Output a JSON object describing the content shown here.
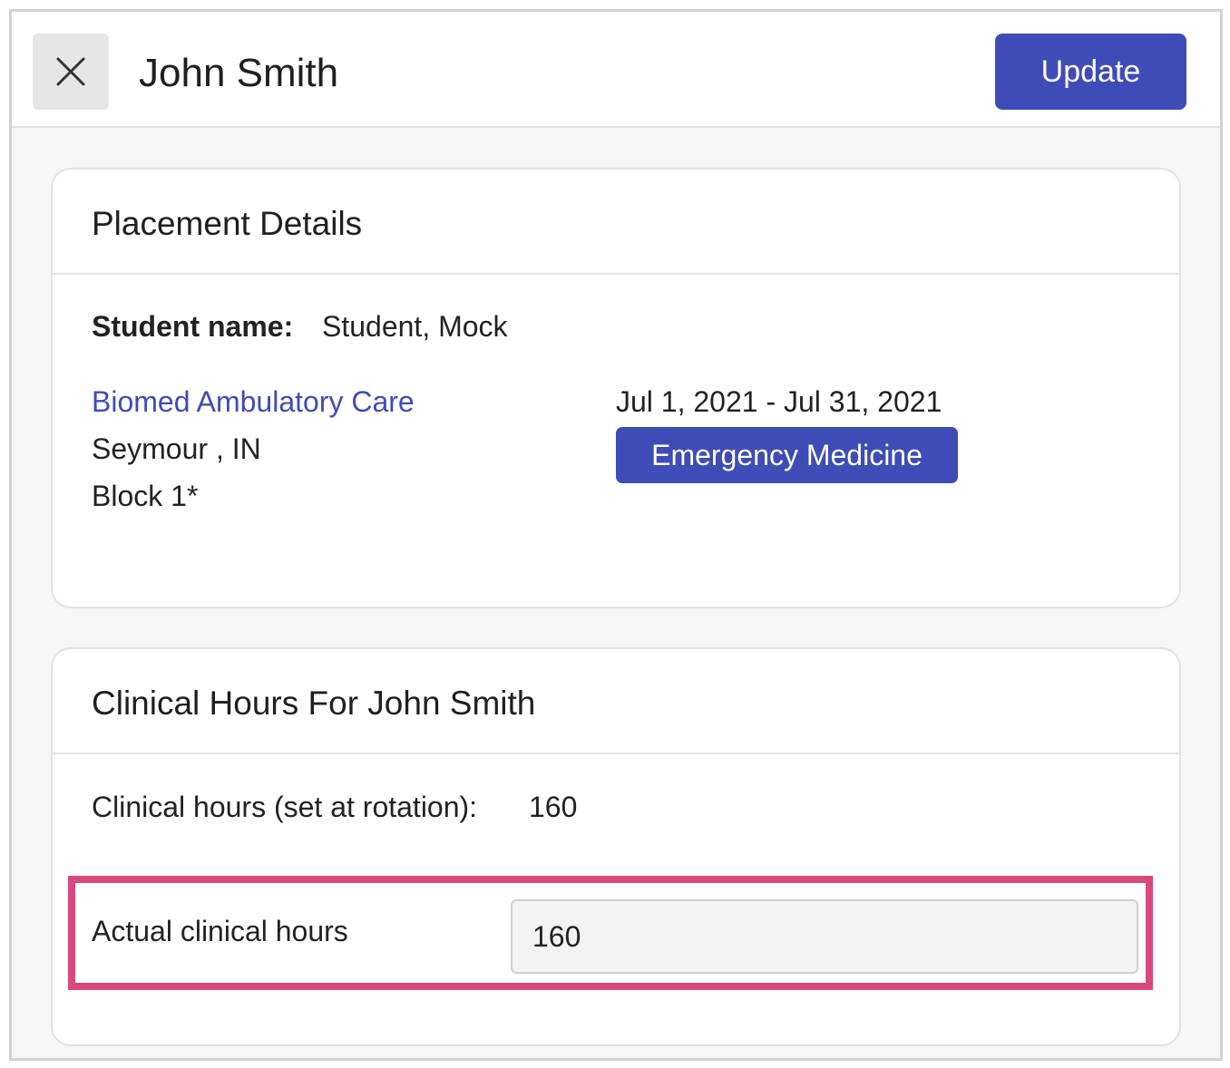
{
  "header": {
    "title": "John Smith",
    "update_label": "Update",
    "close_icon": "close-icon"
  },
  "placement": {
    "title": "Placement Details",
    "student_label": "Student name:",
    "student_value": "Student, Mock",
    "site_name": "Biomed Ambulatory Care",
    "location": "Seymour , IN",
    "block": "Block 1*",
    "date_range": "Jul 1, 2021 - Jul 31, 2021",
    "specialty": "Emergency Medicine"
  },
  "clinical_hours": {
    "title": "Clinical Hours For John Smith",
    "set_label": "Clinical hours (set at rotation):",
    "set_value": "160",
    "actual_label": "Actual clinical hours",
    "actual_value": "160"
  },
  "colors": {
    "primary": "#3f4bb6",
    "highlight": "#d84a7f",
    "background": "#f6f6f6"
  }
}
